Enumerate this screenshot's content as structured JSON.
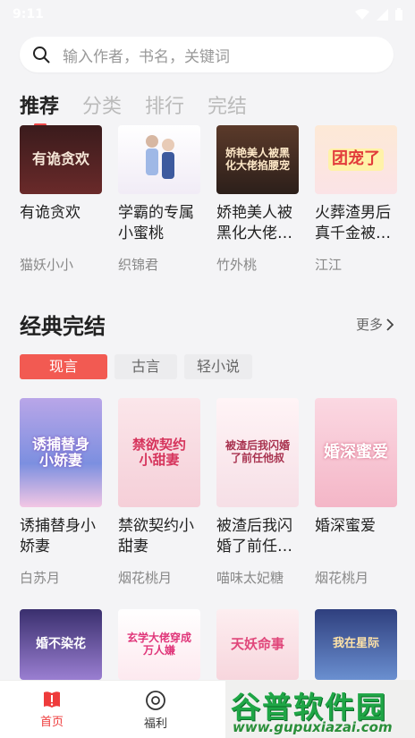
{
  "status_bar": {
    "time": "9:11"
  },
  "search": {
    "placeholder": "输入作者，书名，关键词"
  },
  "tabs": [
    {
      "label": "推荐",
      "active": true
    },
    {
      "label": "分类",
      "active": false
    },
    {
      "label": "排行",
      "active": false
    },
    {
      "label": "完结",
      "active": false
    }
  ],
  "recommended": [
    {
      "title": "有诡贪欢",
      "author": "猫妖小小",
      "cover_text": "有诡贪欢"
    },
    {
      "title": "学霸的专属小蜜桃",
      "author": "织锦君",
      "cover_text": ""
    },
    {
      "title": "娇艳美人被黑化大佬…",
      "author": "竹外桃",
      "cover_text": "娇艳美人被黑化大佬掐腰宠"
    },
    {
      "title": "火葬渣男后真千金被…",
      "author": "江江",
      "cover_text": "团宠了"
    }
  ],
  "classic": {
    "title": "经典完结",
    "more": "更多",
    "chips": [
      {
        "label": "现言",
        "active": true
      },
      {
        "label": "古言",
        "active": false
      },
      {
        "label": "轻小说",
        "active": false
      }
    ],
    "books": [
      {
        "title": "诱捕替身小娇妻",
        "author": "白苏月",
        "cover_text": "诱捕替身小娇妻"
      },
      {
        "title": "禁欲契约小甜妻",
        "author": "烟花桃月",
        "cover_text": "禁欲契约小甜妻"
      },
      {
        "title": "被渣后我闪婚了前任…",
        "author": "喵味太妃糖",
        "cover_text": "被渣后我闪婚了前任他叔"
      },
      {
        "title": "婚深蜜爱",
        "author": "烟花桃月",
        "cover_text": "婚深蜜爱"
      }
    ],
    "next_row_covers": [
      {
        "cover_text": "婚不染花"
      },
      {
        "cover_text": "玄学大佬穿成万人嫌"
      },
      {
        "cover_text": "天妖命事"
      },
      {
        "cover_text": "我在星际"
      }
    ]
  },
  "bottom_nav": [
    {
      "label": "首页",
      "icon": "book-icon",
      "active": true
    },
    {
      "label": "福利",
      "icon": "gift-target-icon",
      "active": false
    }
  ],
  "watermark": {
    "main": "谷普软件园",
    "url": "www.gupuxiazai.com"
  },
  "colors": {
    "accent": "#f04a4a",
    "chip_active": "#f25a52",
    "background": "#f4f4f6"
  }
}
